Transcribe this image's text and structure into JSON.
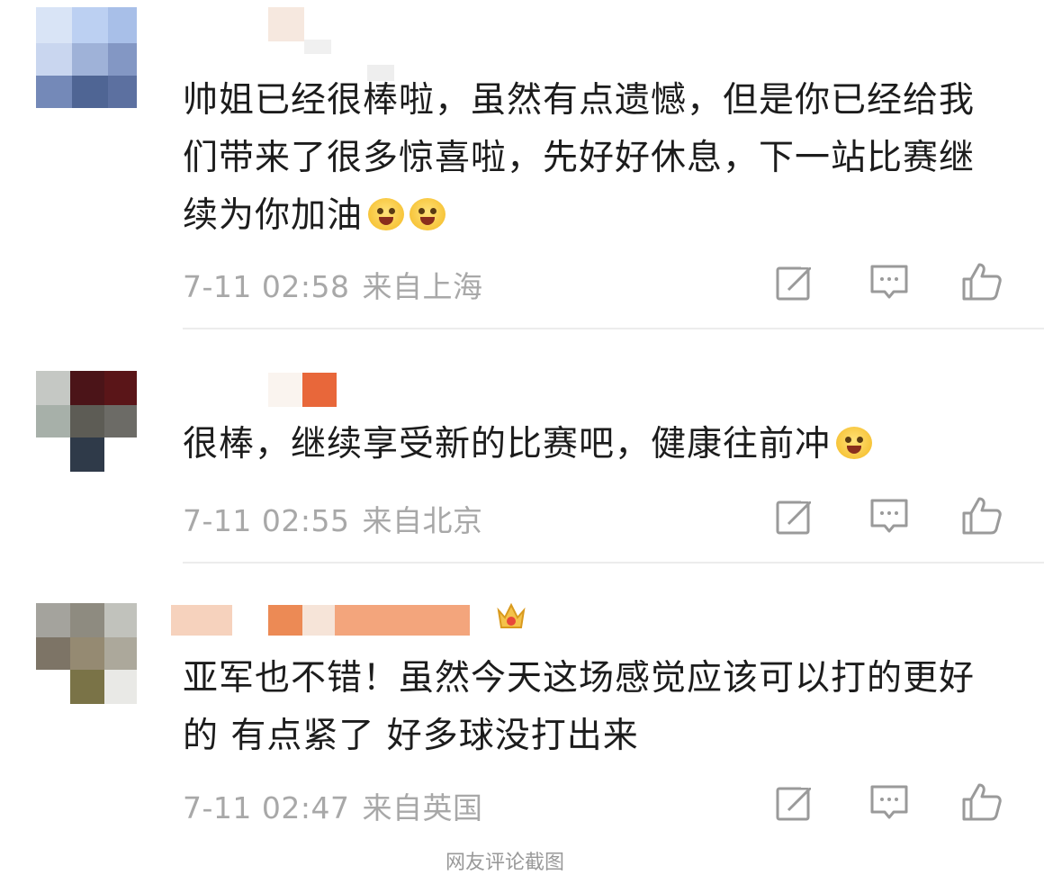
{
  "comments": [
    {
      "text_parts": [
        "帅姐已经很棒啦，虽然有点遗憾，但是你已经给我们带来了很多惊喜啦，先好好休息，下一站比赛继续为你加油"
      ],
      "emojis": [
        "crying-laugh-emoji",
        "crying-laugh-emoji"
      ],
      "time": "7-11 02:58",
      "location": "来自上海"
    },
    {
      "text_parts": [
        "很棒，继续享受新的比赛吧，健康往前冲"
      ],
      "emojis": [
        "blush-emoji"
      ],
      "time": "7-11 02:55",
      "location": "来自北京"
    },
    {
      "text_parts": [
        "亚军也不错！虽然今天这场感觉应该可以打的更好的 有点紧了 好多球没打出来"
      ],
      "emojis": [],
      "time": "7-11 02:47",
      "location": "来自英国"
    }
  ],
  "actions": [
    "share-icon",
    "comment-icon",
    "like-icon"
  ],
  "caption": "网友评论截图",
  "colors": {
    "text": "#1c1c1c",
    "meta": "#a8a8a8",
    "icon": "#9a9a9a",
    "divider": "#ececec"
  }
}
